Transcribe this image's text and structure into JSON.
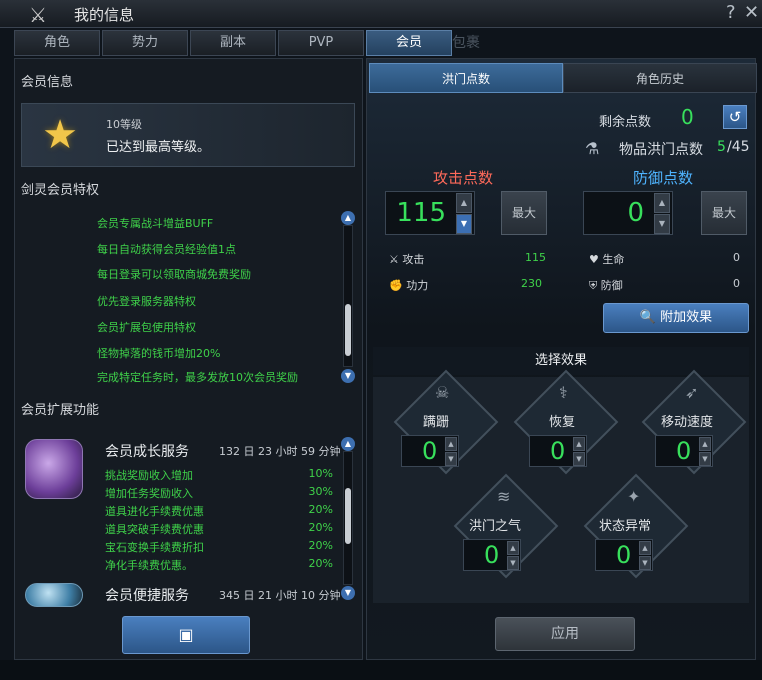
{
  "window": {
    "title": "我的信息",
    "help_label": "?",
    "close_label": "✕"
  },
  "tabs": [
    {
      "label": "角色"
    },
    {
      "label": "势力"
    },
    {
      "label": "副本"
    },
    {
      "label": "PVP"
    },
    {
      "label": "会员"
    }
  ],
  "ghost_tab": {
    "label": "包裹"
  },
  "left": {
    "member_info_heading": "会员信息",
    "vip_level": "10等级",
    "vip_status": "已达到最高等级。",
    "privileges_heading": "剑灵会员特权",
    "privileges": [
      "会员专属战斗增益BUFF",
      "每日自动获得会员经验值1点",
      "每日登录可以领取商城免费奖励",
      "优先登录服务器特权",
      "会员扩展包使用特权",
      "怪物掉落的钱币增加20%",
      "完成特定任务时，最多发放10次会员奖励"
    ],
    "expand_heading": "会员扩展功能",
    "services": [
      {
        "name": "会员成长服务",
        "time": "132 日 23 小时 59 分钟",
        "rows": [
          {
            "label": "挑战奖励收入增加",
            "value": "10%"
          },
          {
            "label": "增加任务奖励收入",
            "value": "30%"
          },
          {
            "label": "道具进化手续费优惠",
            "value": "20%"
          },
          {
            "label": "道具突破手续费优惠",
            "value": "20%"
          },
          {
            "label": "宝石变换手续费折扣",
            "value": "20%"
          },
          {
            "label": "净化手续费优惠。",
            "value": "20%"
          }
        ]
      },
      {
        "name": "会员便捷服务",
        "time": "345 日 21 小时 10 分钟",
        "rows": []
      }
    ]
  },
  "right": {
    "tabs": [
      {
        "label": "洪门点数"
      },
      {
        "label": "角色历史"
      }
    ],
    "remaining_label": "剩余点数",
    "remaining_value": "0",
    "item_points_label": "物品洪门点数",
    "item_points_current": "5",
    "item_points_total": "/45",
    "attack_label": "攻击点数",
    "defense_label": "防御点数",
    "attack_value": "115",
    "defense_value": "0",
    "max_label": "最大",
    "stats": [
      {
        "label": "攻击",
        "value": "115"
      },
      {
        "label": "功力",
        "value": "230"
      },
      {
        "label": "生命",
        "value": "0"
      },
      {
        "label": "防御",
        "value": "0"
      }
    ],
    "effect_button": "附加效果",
    "choose_heading": "选择效果",
    "effects": [
      {
        "name": "蹒跚",
        "value": "0"
      },
      {
        "name": "恢复",
        "value": "0"
      },
      {
        "name": "移动速度",
        "value": "0"
      },
      {
        "name": "洪门之气",
        "value": "0"
      },
      {
        "name": "状态异常",
        "value": "0"
      }
    ],
    "apply_label": "应用"
  },
  "colors": {
    "accent_blue": "#3d6fb0",
    "green_text": "#3fd24a",
    "attack_red": "#ff6a5a",
    "defense_blue": "#4fb4ff"
  }
}
